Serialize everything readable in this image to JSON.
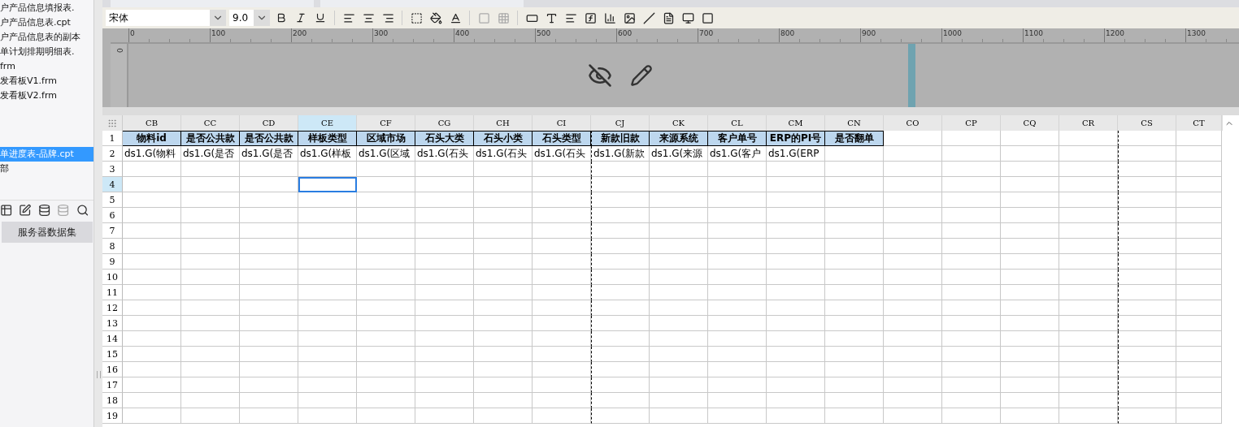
{
  "file_list": {
    "groups": [
      {
        "items": [
          {
            "label": "户产品信息填报表.",
            "selected": false
          },
          {
            "label": "户产品信息表.cpt",
            "selected": false
          },
          {
            "label": "户产品信息表的副本",
            "selected": false
          },
          {
            "label": "单计划排期明细表.",
            "selected": false
          },
          {
            "label": "frm",
            "selected": false
          },
          {
            "label": "发看板V1.frm",
            "selected": false
          },
          {
            "label": "发看板V2.frm",
            "selected": false
          }
        ]
      },
      {
        "items": [
          {
            "label": "单进度表-品牌.cpt",
            "selected": true
          },
          {
            "label": "部",
            "selected": false
          }
        ]
      }
    ]
  },
  "dataset_button": "服务器数据集",
  "toolbar": {
    "font": "宋体",
    "font_size": "9.0"
  },
  "ruler": {
    "ticks": [
      "0",
      "100",
      "200",
      "300",
      "400",
      "500",
      "600",
      "700",
      "800",
      "900",
      "1000",
      "1100",
      "1200",
      "1300"
    ],
    "vertical_tick": "0"
  },
  "sheet": {
    "columns": [
      {
        "name": "CB",
        "header": "物料id",
        "value": "ds1.G(物料",
        "selected": false,
        "page_break": false
      },
      {
        "name": "CC",
        "header": "是否公共款",
        "value": "ds1.G(是否",
        "selected": false,
        "page_break": false
      },
      {
        "name": "CD",
        "header": "是否公共款",
        "value": "ds1.G(是否",
        "selected": false,
        "page_break": false
      },
      {
        "name": "CE",
        "header": "样板类型",
        "value": "ds1.G(样板",
        "selected": true,
        "page_break": false
      },
      {
        "name": "CF",
        "header": "区域市场",
        "value": "ds1.G(区域",
        "selected": false,
        "page_break": false
      },
      {
        "name": "CG",
        "header": "石头大类",
        "value": "ds1.G(石头",
        "selected": false,
        "page_break": false
      },
      {
        "name": "CH",
        "header": "石头小类",
        "value": "ds1.G(石头",
        "selected": false,
        "page_break": false
      },
      {
        "name": "CI",
        "header": "石头类型",
        "value": "ds1.G(石头",
        "selected": false,
        "page_break": false
      },
      {
        "name": "CJ",
        "header": "新款旧款",
        "value": "ds1.G(新款",
        "selected": false,
        "page_break": true
      },
      {
        "name": "CK",
        "header": "来源系统",
        "value": "ds1.G(来源",
        "selected": false,
        "page_break": false
      },
      {
        "name": "CL",
        "header": "客户单号",
        "value": "ds1.G(客户",
        "selected": false,
        "page_break": false
      },
      {
        "name": "CM",
        "header": "ERP的PI号",
        "value": "ds1.G(ERP",
        "selected": false,
        "page_break": false
      },
      {
        "name": "CN",
        "header": "是否翻单",
        "selected": false,
        "page_break": false
      },
      {
        "name": "CO",
        "selected": false,
        "page_break": false
      },
      {
        "name": "CP",
        "selected": false,
        "page_break": false
      },
      {
        "name": "CQ",
        "selected": false,
        "page_break": false
      },
      {
        "name": "CR",
        "selected": false,
        "page_break": false
      },
      {
        "name": "CS",
        "selected": false,
        "page_break": true
      },
      {
        "name": "CT",
        "selected": false,
        "page_break": false
      }
    ],
    "rows": [
      {
        "label": "1",
        "selected": false
      },
      {
        "label": "2",
        "selected": false
      },
      {
        "label": "3",
        "selected": false
      },
      {
        "label": "4",
        "selected": true
      },
      {
        "label": "5",
        "selected": false
      },
      {
        "label": "6",
        "selected": false
      },
      {
        "label": "7",
        "selected": false
      },
      {
        "label": "8",
        "selected": false
      },
      {
        "label": "9",
        "selected": false
      },
      {
        "label": "10",
        "selected": false
      },
      {
        "label": "11",
        "selected": false
      },
      {
        "label": "12",
        "selected": false
      },
      {
        "label": "13",
        "selected": false
      },
      {
        "label": "14",
        "selected": false
      },
      {
        "label": "15",
        "selected": false
      },
      {
        "label": "16",
        "selected": false
      },
      {
        "label": "17",
        "selected": false
      },
      {
        "label": "18",
        "selected": false
      },
      {
        "label": "19",
        "selected": false
      }
    ]
  }
}
